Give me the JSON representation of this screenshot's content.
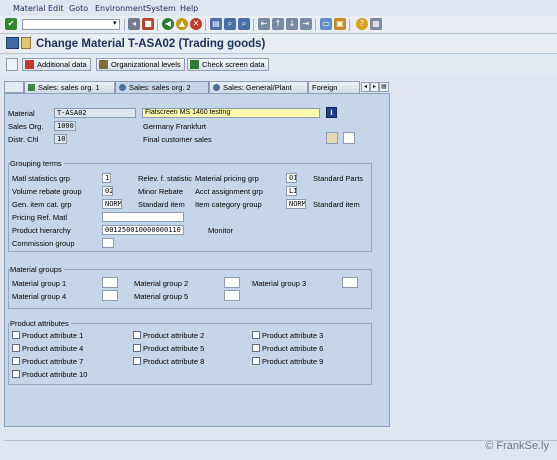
{
  "menu": [
    "Material",
    "Edit",
    "Goto",
    "Environment",
    "System",
    "Help"
  ],
  "title": "Change Material T-ASA02 (Trading goods)",
  "app_toolbar": {
    "additional_data": "Additional data",
    "org_levels": "Organizational levels",
    "check_screen": "Check screen data"
  },
  "tabs": [
    "Sales: sales org. 1",
    "Sales: sales org. 2",
    "Sales: General/Plant",
    "Foreign"
  ],
  "header": {
    "material_label": "Material",
    "material_value": "T-ASA02",
    "description": "Flatscreen MS 1460 testing",
    "sales_org_label": "Sales Org.",
    "sales_org_value": "1000",
    "sales_org_text": "Germany Frankfurt",
    "distr_chl_label": "Distr. Chl",
    "distr_chl_value": "10",
    "distr_chl_text": "Final customer sales"
  },
  "grouping": {
    "title": "Grouping terms",
    "matl_stat_label": "Matl statistics grp",
    "matl_stat_value": "1",
    "relev_label": "Relev. f. statistic",
    "mat_pricing_label": "Material pricing grp",
    "mat_pricing_value": "01",
    "mat_pricing_text": "Standard Parts",
    "vol_rebate_label": "Volume rebate group",
    "vol_rebate_value": "02",
    "vol_rebate_text": "Minor Rebate",
    "acct_label": "Acct assignment grp",
    "acct_value": "LI",
    "gen_item_label": "Gen. item cat. grp",
    "gen_item_value": "NORM",
    "gen_item_text": "Standard item",
    "item_cat_label": "Item category group",
    "item_cat_value": "NORM",
    "item_cat_text": "Standard item",
    "pricing_ref_label": "Pricing Ref. Matl",
    "pricing_ref_value": "",
    "prod_hier_label": "Product hierarchy",
    "prod_hier_value": "001250010000000110",
    "prod_hier_text": "Monitor",
    "commission_label": "Commission group",
    "commission_value": ""
  },
  "mat_groups": {
    "title": "Material groups",
    "g1": "Material group 1",
    "g2": "Material group 2",
    "g3": "Material group 3",
    "g4": "Material group 4",
    "g5": "Material group 5"
  },
  "prod_attrs": {
    "title": "Product attributes",
    "a1": "Product attribute 1",
    "a2": "Product attribute 2",
    "a3": "Product attribute 3",
    "a4": "Product attribute 4",
    "a5": "Product attribute 5",
    "a6": "Product attribute 6",
    "a7": "Product attribute 7",
    "a8": "Product attribute 8",
    "a9": "Product attribute 9",
    "a10": "Product attribute 10"
  },
  "watermark": "© FrankSe.ly",
  "colors": {
    "background": "#dfe6ef",
    "panel": "#c6d6ea",
    "title_text": "#1e2d5a",
    "description_field": "#fff8b0"
  }
}
